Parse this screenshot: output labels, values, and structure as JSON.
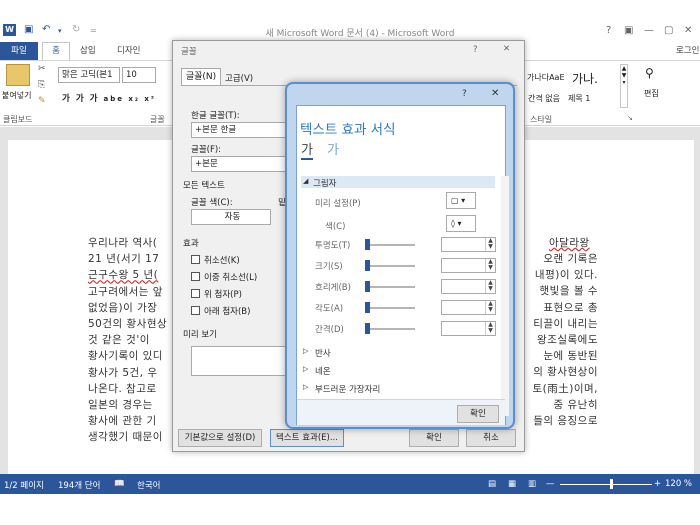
{
  "app": {
    "window_title": "새 Microsoft Word 문서 (4) - Microsoft Word",
    "account": "로그인",
    "qat_help": "?"
  },
  "ribbon": {
    "tabs": [
      "파일",
      "홈",
      "삽입",
      "디자인"
    ],
    "clipboard": {
      "paste_label": "붙여넣기",
      "group": "클립보드"
    },
    "font": {
      "name": "맑은 고딕(본1",
      "size": "10",
      "group": "글꼴"
    },
    "styles": {
      "items": [
        "가나다AaE",
        "가나다AaE",
        "가나."
      ],
      "labels": [
        "간격 없음",
        "제목 1"
      ],
      "group": "스타일"
    },
    "editing": {
      "label": "편집"
    }
  },
  "document": {
    "lines": [
      "우리나라  역사(",
      "21  년(서기  17",
      "근구수왕  5  년(",
      "고구려에서는  앞",
      "없었음)이  가장",
      "50건의  황사현상",
      "것  같은  것'이",
      "황사기록이  있디",
      "황사가  5건,  우",
      "나온다.  참고로",
      "일본의  경우는",
      "황사에  관한  기",
      "생각했기  때문이"
    ],
    "right_lines": [
      "오랜  기록은",
      "내평)이  있다.",
      "햇빛을  볼  수",
      "표현으로  총",
      "티끌이  내리는",
      "왕조실록에도",
      "눈에  동반된",
      "의  황사현상이",
      "토(雨土)이며,",
      "중  유난히",
      "들의  응징으로"
    ],
    "right_top": "아달라왕"
  },
  "status": {
    "page": "1/2 페이지",
    "words": "194개 단어",
    "lang": "한국어",
    "zoom": "120 %"
  },
  "font_dialog": {
    "title": "글꼴",
    "help": "?",
    "tabs": [
      "글꼴(N)",
      "고급(V)"
    ],
    "korean_font_label": "한글 글꼴(T):",
    "korean_font_value": "+본문 한글",
    "font_label": "글꼴(F):",
    "font_value": "+본문",
    "all_text_label": "모든 텍스트",
    "color_label": "글꼴 색(C):",
    "color_value": "자동",
    "underline_short": "밑",
    "effects_label": "효과",
    "effects": [
      "취소선(K)",
      "이중 취소선(L)",
      "위 첨자(P)",
      "아래 첨자(B)"
    ],
    "preview_label": "미리 보기",
    "default_button": "기본값으로 설정(D)",
    "text_effects_button": "텍스트 효과(E)...",
    "ok_button": "확인",
    "cancel_button": "취소"
  },
  "fx_dialog": {
    "help": "?",
    "close": "✕",
    "title": "텍스트 효과 서식",
    "tab_icons": [
      "가",
      "가"
    ],
    "shadow_section": "그림자",
    "presets_label": "미리 설정(P)",
    "color_label": "색(C)",
    "sliders": [
      "투명도(T)",
      "크기(S)",
      "흐리게(B)",
      "각도(A)",
      "간격(D)"
    ],
    "sections": [
      "반사",
      "네온",
      "부드러운 가장자리"
    ],
    "ok_button": "확인"
  }
}
